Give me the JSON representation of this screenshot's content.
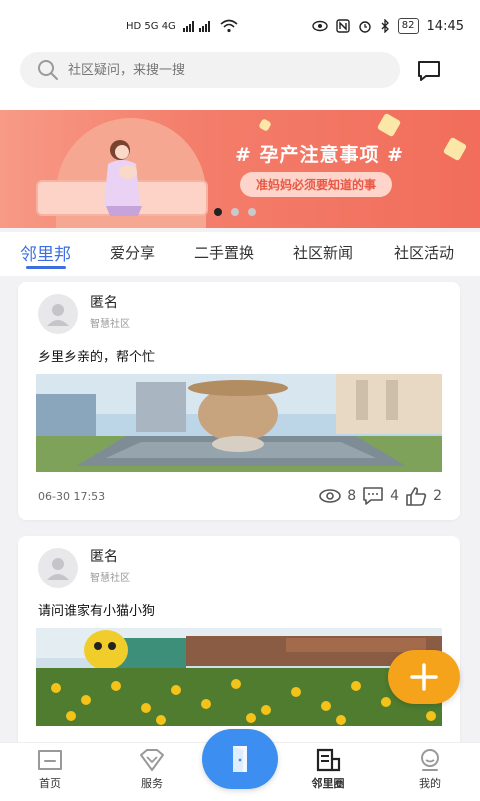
{
  "status_bar": {
    "left_indicators": "HD 5G 4G",
    "battery": "82",
    "time": "14:45"
  },
  "search": {
    "placeholder": "社区疑问，来搜一搜"
  },
  "banner": {
    "title": "# 孕产注意事项 #",
    "subtitle": "准妈妈必须要知道的事"
  },
  "tabs": [
    {
      "label": "邻里邦"
    },
    {
      "label": "爱分享"
    },
    {
      "label": "二手置换"
    },
    {
      "label": "社区新闻"
    },
    {
      "label": "社区活动"
    }
  ],
  "posts": [
    {
      "author": "匿名",
      "community": "智慧社区",
      "text": "乡里乡亲的，帮个忙",
      "time": "06-30 17:53",
      "views": "8",
      "comments": "4",
      "likes": "2"
    },
    {
      "author": "匿名",
      "community": "智慧社区",
      "text": "请问谁家有小猫小狗"
    }
  ],
  "bottom_nav": [
    {
      "label": "首页"
    },
    {
      "label": "服务"
    },
    {
      "label": "邻里圈"
    },
    {
      "label": "我的"
    }
  ],
  "colors": {
    "accent": "#3e6fe0",
    "fab": "#f5a31b",
    "center_button": "#3c8ff0"
  }
}
